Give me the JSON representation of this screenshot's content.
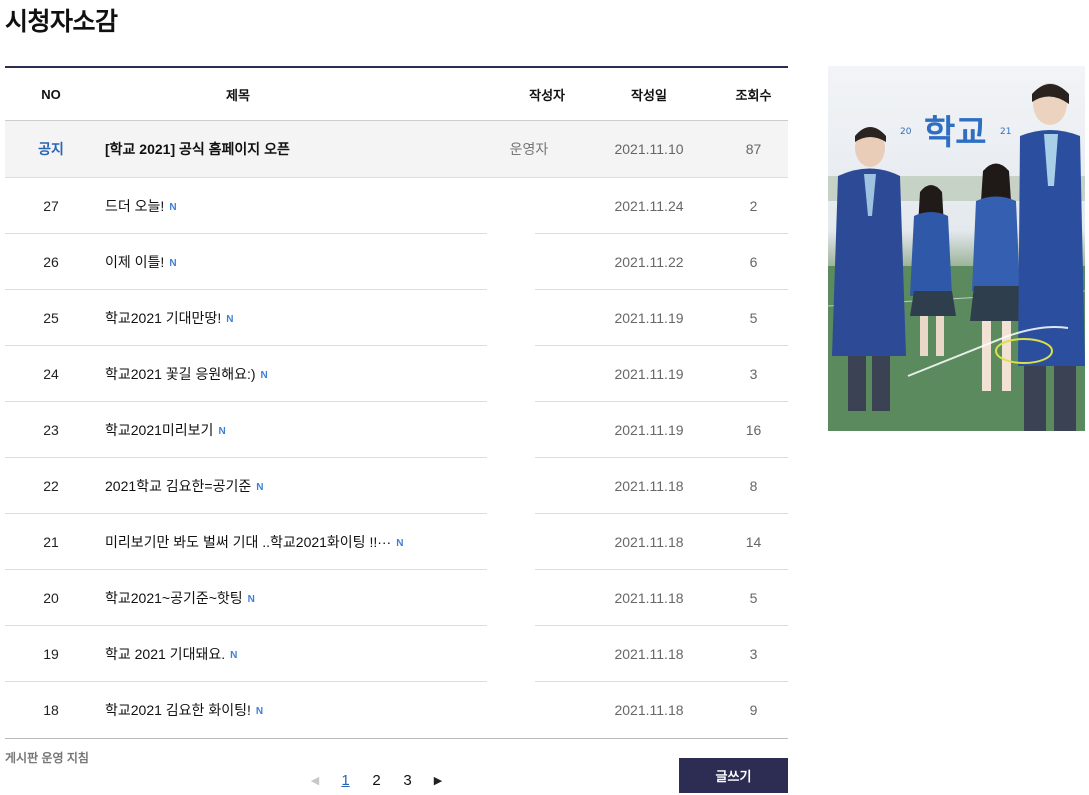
{
  "page": {
    "title": "시청자소감"
  },
  "table": {
    "headers": {
      "no": "NO",
      "title": "제목",
      "writer": "작성자",
      "date": "작성일",
      "views": "조회수"
    },
    "notice": {
      "no": "공지",
      "title": "[학교 2021] 공식 홈페이지 오픈",
      "writer": "운영자",
      "date": "2021.11.10",
      "views": "87"
    },
    "rows": [
      {
        "no": "27",
        "title": "드더 오늘!",
        "badge": "N",
        "date": "2021.11.24",
        "views": "2"
      },
      {
        "no": "26",
        "title": "이제 이틀!",
        "badge": "N",
        "date": "2021.11.22",
        "views": "6"
      },
      {
        "no": "25",
        "title": "학교2021 기대만땅!",
        "badge": "N",
        "date": "2021.11.19",
        "views": "5"
      },
      {
        "no": "24",
        "title": "학교2021 꽃길 응원해요:)",
        "badge": "N",
        "date": "2021.11.19",
        "views": "3"
      },
      {
        "no": "23",
        "title": "학교2021미리보기",
        "badge": "N",
        "date": "2021.11.19",
        "views": "16"
      },
      {
        "no": "22",
        "title": "2021학교 김요한=공기준",
        "badge": "N",
        "date": "2021.11.18",
        "views": "8"
      },
      {
        "no": "21",
        "title": "미리보기만 봐도 벌써 기대 ..학교2021화이팅 !!···",
        "badge": "N",
        "date": "2021.11.18",
        "views": "14"
      },
      {
        "no": "20",
        "title": "학교2021~공기준~핫팅",
        "badge": "N",
        "date": "2021.11.18",
        "views": "5"
      },
      {
        "no": "19",
        "title": "학교 2021 기대돼요.",
        "badge": "N",
        "date": "2021.11.18",
        "views": "3"
      },
      {
        "no": "18",
        "title": "학교2021 김요한 화이팅!",
        "badge": "N",
        "date": "2021.11.18",
        "views": "9"
      }
    ]
  },
  "footer": {
    "guide_link": "게시판 운영 지침",
    "pagination": {
      "pages": [
        "1",
        "2",
        "3"
      ],
      "current": "1",
      "prev_icon": "chevron-left-icon",
      "next_icon": "chevron-right-icon"
    },
    "write_button": "글쓰기"
  },
  "poster": {
    "logo_text": "학교",
    "year_left": "20",
    "year_right": "21"
  },
  "colors": {
    "accent": "#2d2d54",
    "link_blue": "#2a63b4",
    "badge_blue": "#3c7fd8"
  }
}
